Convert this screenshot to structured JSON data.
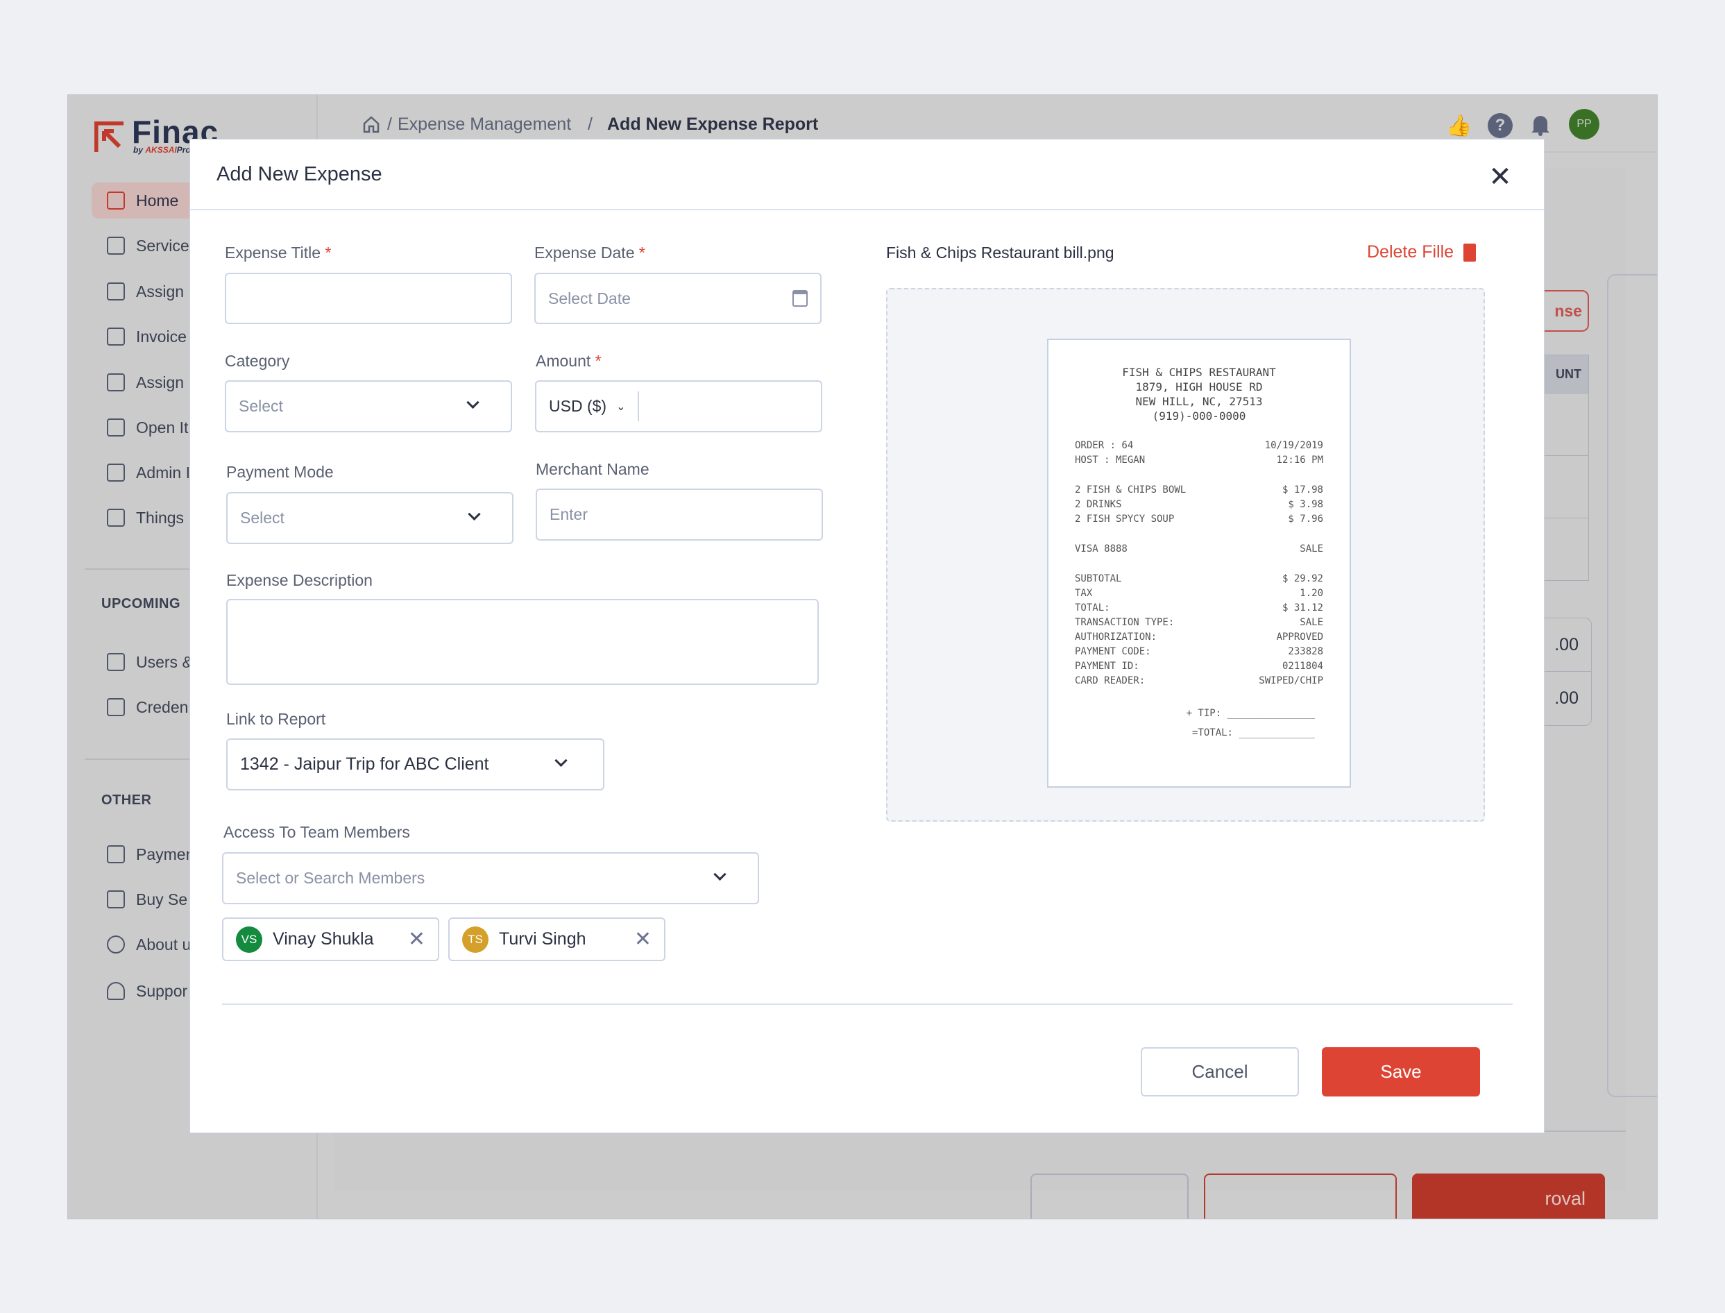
{
  "app": {
    "logo": {
      "name": "Finac",
      "by": "by",
      "company": "AKSSAI",
      "suffix": "Proj"
    },
    "sidebar": {
      "items": [
        {
          "label": "Home",
          "icon": "home-icon",
          "active": true
        },
        {
          "label": "Service",
          "icon": "grid-icon"
        },
        {
          "label": "Assign",
          "icon": "columns-icon"
        },
        {
          "label": "Invoice",
          "icon": "invoice-icon"
        },
        {
          "label": "Assign",
          "icon": "user-plus-icon"
        },
        {
          "label": "Open It",
          "icon": "printer-icon"
        },
        {
          "label": "Admin I",
          "icon": "bar-chart-icon"
        },
        {
          "label": "Things",
          "icon": "list-icon"
        }
      ],
      "upcoming_title": "UPCOMING",
      "upcoming": [
        {
          "label": "Users &",
          "icon": "users-icon"
        },
        {
          "label": "Creden",
          "icon": "credentials-icon"
        }
      ],
      "other_title": "OTHER",
      "other": [
        {
          "label": "Paymen",
          "icon": "wallet-icon"
        },
        {
          "label": "Buy Se",
          "icon": "cart-icon"
        },
        {
          "label": "About u",
          "icon": "info-icon"
        },
        {
          "label": "Suppor",
          "icon": "headset-icon"
        }
      ]
    },
    "breadcrumb": {
      "sep": "/",
      "parent": "Expense Management",
      "current": "Add New Expense Report"
    },
    "user_initials": "PP",
    "background": {
      "button_partial": "nse",
      "table_header_partial": "UNT",
      "totals": [
        ".00",
        ".00"
      ],
      "approval_partial": "roval"
    }
  },
  "modal": {
    "title": "Add New Expense",
    "fields": {
      "expense_title": {
        "label": "Expense Title",
        "required": "*",
        "value": ""
      },
      "expense_date": {
        "label": "Expense Date",
        "required": "*",
        "placeholder": "Select Date"
      },
      "category": {
        "label": "Category",
        "placeholder": "Select"
      },
      "amount": {
        "label": "Amount",
        "required": "*",
        "currency": "USD ($)",
        "value": ""
      },
      "payment_mode": {
        "label": "Payment Mode",
        "placeholder": "Select"
      },
      "merchant_name": {
        "label": "Merchant Name",
        "placeholder": "Enter"
      },
      "description": {
        "label": "Expense Description",
        "value": ""
      },
      "link_to_report": {
        "label": "Link to Report",
        "value": "1342 - Jaipur Trip for ABC Client"
      },
      "team_access": {
        "label": "Access To Team Members",
        "placeholder": "Select or Search Members"
      }
    },
    "members": [
      {
        "initials": "VS",
        "name": "Vinay Shukla",
        "color": "#148a3e"
      },
      {
        "initials": "TS",
        "name": "Turvi Singh",
        "color": "#d4a02a"
      }
    ],
    "file": {
      "name": "Fish & Chips Restaurant bill.png",
      "delete_label": "Delete Fille"
    },
    "receipt": {
      "header": [
        "FISH & CHIPS RESTAURANT",
        "1879, HIGH HOUSE RD",
        "NEW HILL, NC, 27513",
        "(919)-000-0000"
      ],
      "meta": [
        [
          "ORDER : 64",
          "10/19/2019"
        ],
        [
          "HOST : MEGAN",
          "12:16 PM"
        ]
      ],
      "items": [
        [
          "2 FISH & CHIPS BOWL",
          "$ 17.98"
        ],
        [
          "2 DRINKS",
          "$ 3.98"
        ],
        [
          "2 FISH SPYCY SOUP",
          "$ 7.96"
        ]
      ],
      "card": [
        [
          "VISA 8888",
          "SALE"
        ]
      ],
      "summary": [
        [
          "SUBTOTAL",
          "$ 29.92"
        ],
        [
          "TAX",
          "1.20"
        ],
        [
          "TOTAL:",
          "$ 31.12"
        ],
        [
          "TRANSACTION TYPE:",
          "SALE"
        ],
        [
          "AUTHORIZATION:",
          "APPROVED"
        ],
        [
          "PAYMENT CODE:",
          "233828"
        ],
        [
          "PAYMENT ID:",
          "0211804"
        ],
        [
          "CARD READER:",
          "SWIPED/CHIP"
        ]
      ],
      "tip": "+ TIP: _______________",
      "total_line": "=TOTAL: _____________"
    },
    "cancel_label": "Cancel",
    "save_label": "Save",
    "colors": {
      "accent": "#de4433",
      "border": "#cdd4e4",
      "avatar_user": "#3a7026"
    }
  }
}
